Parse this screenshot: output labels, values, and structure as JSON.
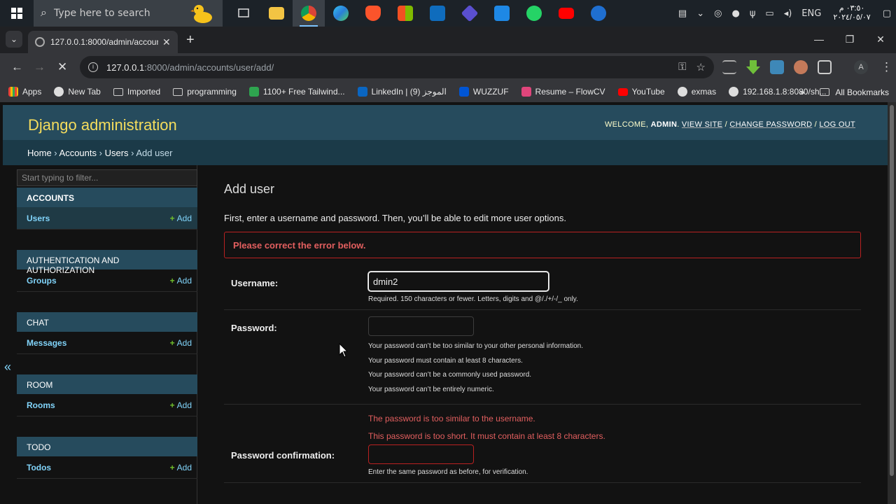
{
  "taskbar": {
    "search_placeholder": "Type here to search",
    "tray_lang": "ENG",
    "clock_time": "٠٣:٥٠ م",
    "clock_date": "٢٠٢٤/٠٥/٠٧"
  },
  "browser": {
    "tab_title": "127.0.0.1:8000/admin/accounts",
    "url_host": "127.0.0.1",
    "url_path": ":8000/admin/accounts/user/add/",
    "avatar_letter": "A",
    "bookmarks": [
      {
        "label": "Apps",
        "icon": "apps-grid-icon"
      },
      {
        "label": "New Tab",
        "icon": "person-icon"
      },
      {
        "label": "Imported",
        "icon": "folder-icon"
      },
      {
        "label": "programming",
        "icon": "folder-icon"
      },
      {
        "label": "1100+ Free Tailwind...",
        "icon": "tailwind-icon"
      },
      {
        "label": "LinkedIn | الموجز (9)",
        "icon": "linkedin-icon"
      },
      {
        "label": "WUZZUF",
        "icon": "wuzzuf-icon"
      },
      {
        "label": "Resume – FlowCV",
        "icon": "flowcv-icon"
      },
      {
        "label": "YouTube",
        "icon": "youtube-icon"
      },
      {
        "label": "exmas",
        "icon": "globe-icon"
      },
      {
        "label": "192.168.1.8:8080/sh...",
        "icon": "globe-icon"
      }
    ],
    "all_bookmarks": "All Bookmarks"
  },
  "admin": {
    "brand": "Django administration",
    "welcome": "WELCOME,",
    "username": "ADMIN",
    "view_site": "VIEW SITE",
    "change_password": "CHANGE PASSWORD",
    "log_out": "LOG OUT",
    "breadcrumbs": {
      "home": "Home",
      "app": "Accounts",
      "model": "Users",
      "current": "Add user"
    },
    "filter_placeholder": "Start typing to filter...",
    "add_label": "Add",
    "modules": [
      {
        "caption": "ACCOUNTS",
        "model": "Users"
      },
      {
        "caption": "AUTHENTICATION AND AUTHORIZATION",
        "model": "Groups"
      },
      {
        "caption": "CHAT",
        "model": "Messages"
      },
      {
        "caption": "ROOM",
        "model": "Rooms"
      },
      {
        "caption": "TODO",
        "model": "Todos"
      }
    ],
    "collapse": "«"
  },
  "form": {
    "title": "Add user",
    "intro": "First, enter a username and password. Then, you’ll be able to edit more user options.",
    "error_note": "Please correct the error below.",
    "username_label": "Username:",
    "username_value": "dmin2",
    "username_help": "Required. 150 characters or fewer. Letters, digits and @/./+/-/_ only.",
    "password_label": "Password:",
    "password_help": [
      "Your password can’t be too similar to your other personal information.",
      "Your password must contain at least 8 characters.",
      "Your password can’t be a commonly used password.",
      "Your password can’t be entirely numeric."
    ],
    "errors": [
      "The password is too similar to the username.",
      "This password is too short. It must contain at least 8 characters."
    ],
    "confirm_label": "Password confirmation:",
    "confirm_help": "Enter the same password as before, for verification."
  },
  "colors": {
    "header_bg": "#264b5d",
    "brand": "#f5dd5d",
    "link": "#81d4fa",
    "error": "#e35f5f",
    "add_plus": "#70bf2b"
  }
}
